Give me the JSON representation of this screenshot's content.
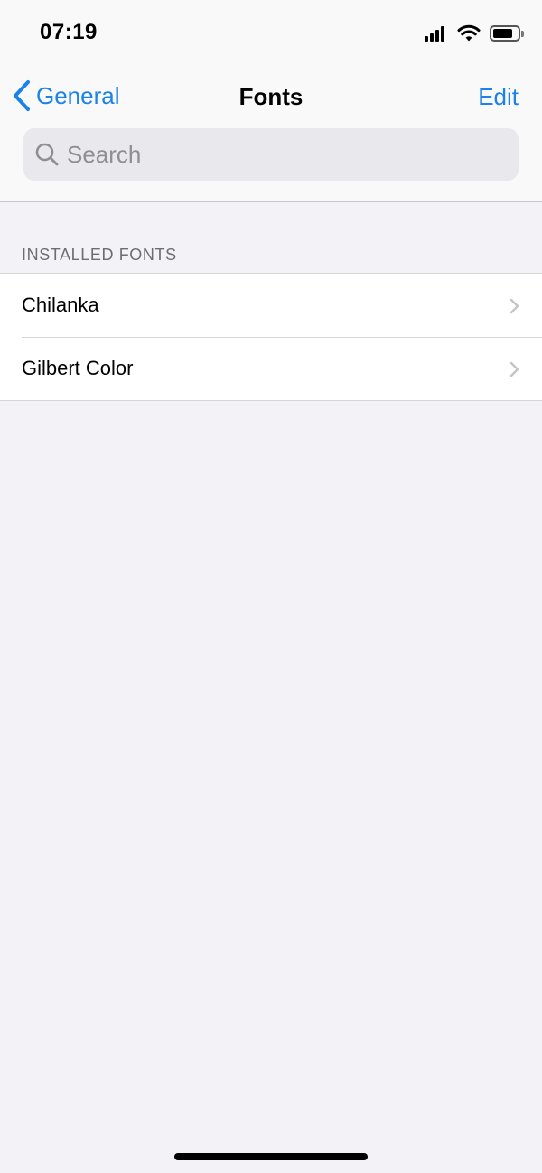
{
  "status_bar": {
    "time": "07:19",
    "signal_icon": "cellular-signal-icon",
    "wifi_icon": "wifi-icon",
    "battery_icon": "battery-icon",
    "battery_level": 0.8
  },
  "nav": {
    "back_label": "General",
    "back_icon": "chevron-left-icon",
    "title": "Fonts",
    "edit_label": "Edit"
  },
  "search": {
    "placeholder": "Search",
    "value": "",
    "icon": "search-icon"
  },
  "installed_fonts": {
    "header": "INSTALLED FONTS",
    "items": [
      {
        "label": "Chilanka",
        "icon": "chevron-right-icon"
      },
      {
        "label": "Gilbert Color",
        "icon": "chevron-right-icon"
      }
    ]
  },
  "colors": {
    "accent": "#1a82e8",
    "background": "#f2f2f7",
    "nav_background": "#f9f9f9",
    "row_background": "#ffffff"
  }
}
